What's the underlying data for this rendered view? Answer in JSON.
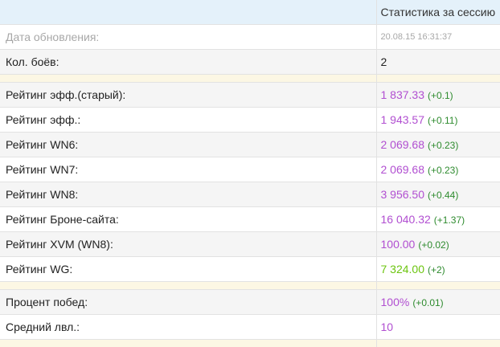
{
  "header": {
    "col1": "",
    "col2": "Статистика за сессию"
  },
  "updated": {
    "label": "Дата обновления:",
    "value": "20.08.15 16:31:37"
  },
  "battles": {
    "label": "Кол. боёв:",
    "value": "2"
  },
  "ratings": [
    {
      "label": "Рейтинг эфф.(старый):",
      "value": "1 837.33",
      "delta": "(+0.1)",
      "color": "#b14fd1"
    },
    {
      "label": "Рейтинг эфф.:",
      "value": "1 943.57",
      "delta": "(+0.11)",
      "color": "#b14fd1"
    },
    {
      "label": "Рейтинг WN6:",
      "value": "2 069.68",
      "delta": "(+0.23)",
      "color": "#b14fd1"
    },
    {
      "label": "Рейтинг WN7:",
      "value": "2 069.68",
      "delta": "(+0.23)",
      "color": "#b14fd1"
    },
    {
      "label": "Рейтинг WN8:",
      "value": "3 956.50",
      "delta": "(+0.44)",
      "color": "#b14fd1"
    },
    {
      "label": "Рейтинг Броне-сайта:",
      "value": "16 040.32",
      "delta": "(+1.37)",
      "color": "#b14fd1"
    },
    {
      "label": "Рейтинг XVM (WN8):",
      "value": "100.00",
      "delta": "(+0.02)",
      "color": "#b14fd1"
    },
    {
      "label": "Рейтинг WG:",
      "value": "7 324.00",
      "delta": "(+2)",
      "color": "#6cc50f"
    }
  ],
  "winrate": {
    "label": "Процент побед:",
    "value": "100%",
    "delta": "(+0.01)",
    "color": "#b14fd1"
  },
  "avg_level": {
    "label": "Средний лвл.:",
    "value": "10",
    "color": "#b14fd1"
  }
}
